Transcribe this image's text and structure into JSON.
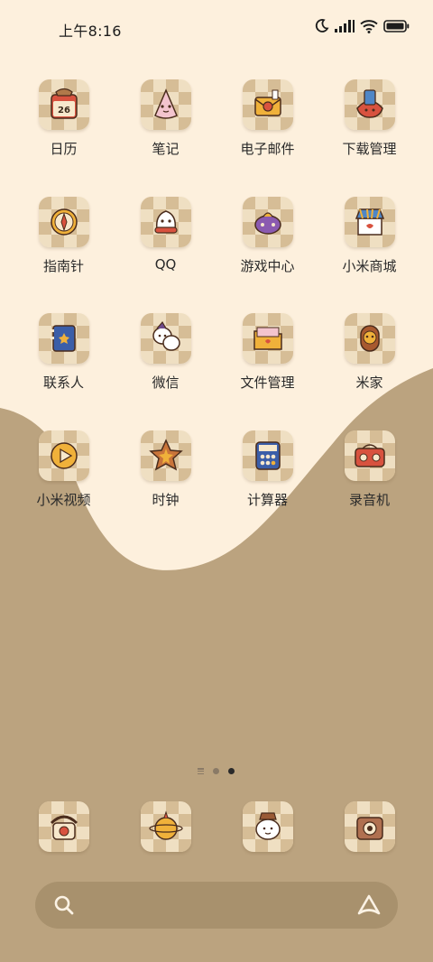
{
  "status": {
    "time": "上午8:16",
    "icons": [
      "moon-icon",
      "signal-icon",
      "wifi-icon",
      "battery-icon"
    ]
  },
  "apps": [
    {
      "label": "日历",
      "icon": "calendar-icon",
      "badge_text": "26"
    },
    {
      "label": "笔记",
      "icon": "notes-icon"
    },
    {
      "label": "电子邮件",
      "icon": "mail-icon"
    },
    {
      "label": "下载管理",
      "icon": "download-icon"
    },
    {
      "label": "指南针",
      "icon": "compass-icon"
    },
    {
      "label": "QQ",
      "icon": "qq-icon"
    },
    {
      "label": "游戏中心",
      "icon": "game-center-icon"
    },
    {
      "label": "小米商城",
      "icon": "shop-icon"
    },
    {
      "label": "联系人",
      "icon": "contacts-icon"
    },
    {
      "label": "微信",
      "icon": "wechat-icon"
    },
    {
      "label": "文件管理",
      "icon": "files-icon"
    },
    {
      "label": "米家",
      "icon": "mijia-icon"
    },
    {
      "label": "小米视频",
      "icon": "video-icon"
    },
    {
      "label": "时钟",
      "icon": "clock-icon"
    },
    {
      "label": "计算器",
      "icon": "calculator-icon"
    },
    {
      "label": "录音机",
      "icon": "recorder-icon"
    }
  ],
  "dock": [
    {
      "icon": "phone-icon"
    },
    {
      "icon": "browser-icon"
    },
    {
      "icon": "messages-icon"
    },
    {
      "icon": "camera-icon"
    }
  ],
  "page_indicator": {
    "pages": 2,
    "current": 2
  },
  "colors": {
    "background_top": "#fdf0dd",
    "wave": "#bba37f",
    "search_bar": "#a8916d",
    "icon_checker_light": "#f2e3c8",
    "icon_checker_dark": "#d9c09a"
  }
}
